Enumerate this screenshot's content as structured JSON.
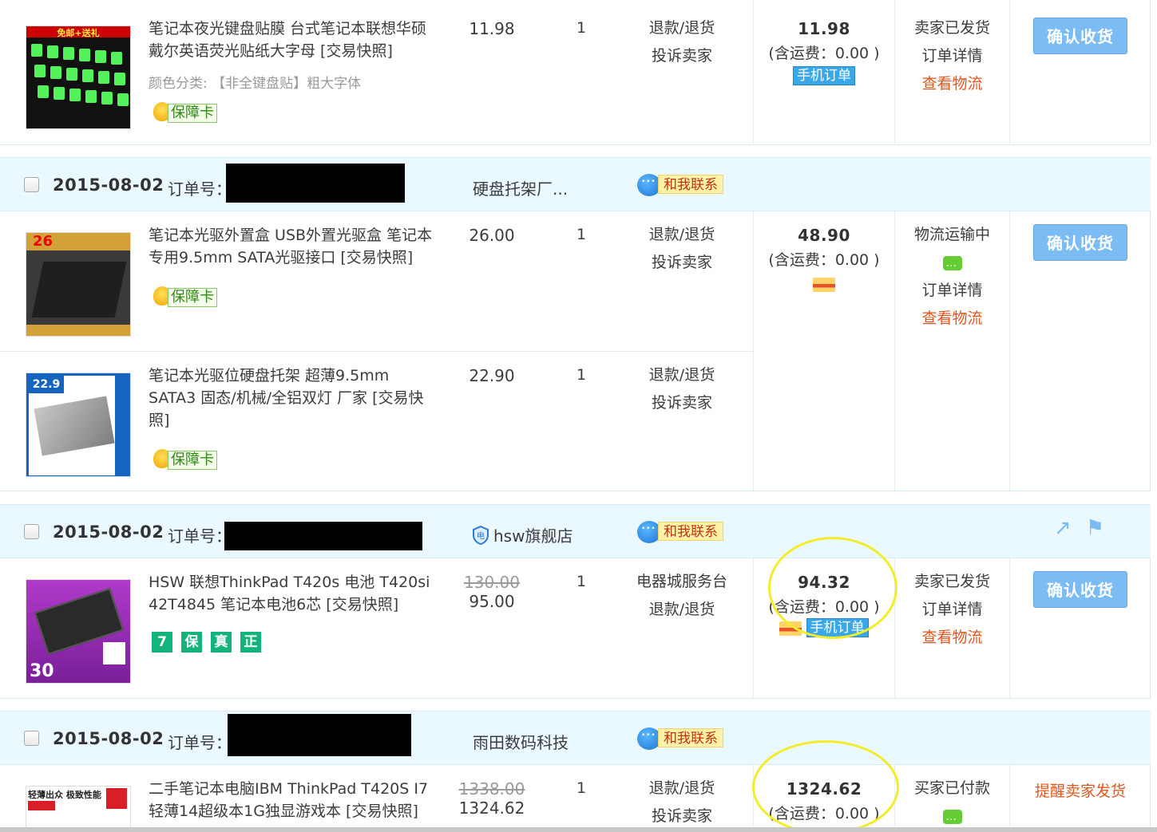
{
  "orders": [
    {
      "items": [
        {
          "title": "笔记本夜光键盘贴膜 台式笔记本联想华硕戴尔英语荧光贴纸大字母 [交易快照]",
          "sku": "颜色分类: 【非全键盘贴】粗大字体",
          "guard": "保障卡",
          "price": "11.98",
          "qty": "1",
          "ops": [
            "退款/退货",
            "投诉卖家"
          ],
          "thumb_text": "免邮+送礼"
        }
      ],
      "total": "11.98",
      "freight": "(含运费：0.00 )",
      "badge": "手机订单",
      "status": [
        "卖家已发货",
        "订单详情",
        "查看物流"
      ],
      "action": "确认收货"
    },
    {
      "date": "2015-08-02",
      "order_label": "订单号：",
      "shop": "硬盘托架厂...",
      "contact": "和我联系",
      "items": [
        {
          "title": "笔记本光驱外置盒 USB外置光驱盒 笔记本专用9.5mm SATA光驱接口 [交易快照]",
          "guard": "保障卡",
          "price": "26.00",
          "qty": "1",
          "ops": [
            "退款/退货",
            "投诉卖家"
          ],
          "thumb_text": "26"
        },
        {
          "title": "笔记本光驱位硬盘托架 超薄9.5mm SATA3 固态/机械/全铝双灯 厂家 [交易快照]",
          "guard": "保障卡",
          "price": "22.90",
          "qty": "1",
          "ops": [
            "退款/退货",
            "投诉卖家"
          ],
          "thumb_text": "22.9"
        }
      ],
      "total": "48.90",
      "freight": "(含运费：0.00 )",
      "status": [
        "物流运输中",
        "订单详情",
        "查看物流"
      ],
      "action": "确认收货"
    },
    {
      "date": "2015-08-02",
      "order_label": "订单号：",
      "shop": "hsw旗舰店",
      "contact": "和我联系",
      "items": [
        {
          "title": "HSW 联想ThinkPad T420s 电池 T420si 42T4845 笔记本电池6芯 [交易快照]",
          "old_price": "130.00",
          "price": "95.00",
          "qty": "1",
          "ops": [
            "电器城服务台",
            "退款/退货"
          ],
          "badges": [
            "7",
            "保",
            "真",
            "正"
          ],
          "thumb_text": "30"
        }
      ],
      "total": "94.32",
      "freight": "(含运费：0.00 )",
      "badge": "手机订单",
      "status": [
        "卖家已发货",
        "订单详情",
        "查看物流"
      ],
      "action": "确认收货"
    },
    {
      "date": "2015-08-02",
      "order_label": "订单号：",
      "shop": "雨田数码科技",
      "contact": "和我联系",
      "items": [
        {
          "title": "二手笔记本电脑IBM ThinkPad T420S I7 轻薄14超级本1G独显游戏本 [交易快照]",
          "old_price": "1338.00",
          "price": "1324.62",
          "qty": "1",
          "ops": [
            "退款/退货",
            "投诉卖家"
          ],
          "thumb_text": "轻薄出众 极致性能"
        }
      ],
      "total": "1324.62",
      "freight": "(含运费：0.00 )",
      "status": [
        "买家已付款"
      ],
      "action": "提醒卖家发货"
    }
  ],
  "colors": {
    "header_bg": "#eaf8ff",
    "button": "#7cbcf5",
    "link_orange": "#e2561e",
    "highlight": "#f3ec2a"
  }
}
